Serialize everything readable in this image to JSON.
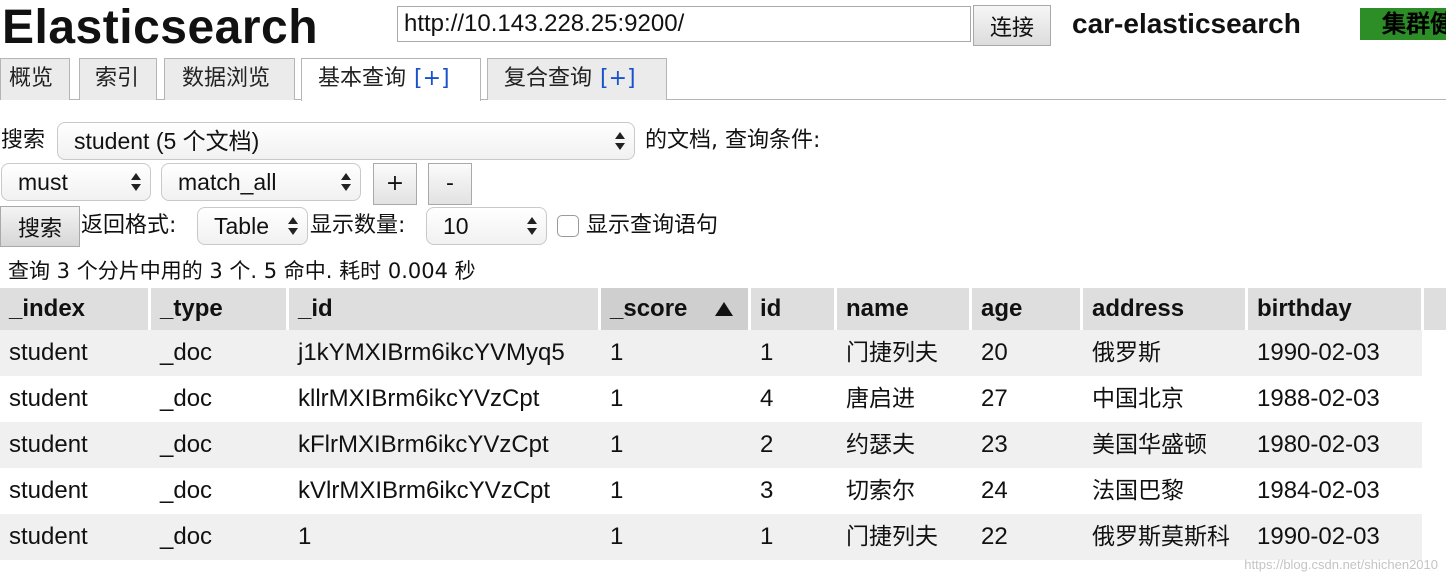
{
  "header": {
    "title": "Elasticsearch",
    "url_value": "http://10.143.228.25:9200/",
    "connect_label": "连接",
    "cluster_name": "car-elasticsearch",
    "cluster_health": "集群健",
    "health_color": "#2d8d27"
  },
  "tabs": [
    {
      "label": "概览",
      "plus": ""
    },
    {
      "label": "索引",
      "plus": ""
    },
    {
      "label": "数据浏览",
      "plus": ""
    },
    {
      "label": "基本查询",
      "plus": "[+]"
    },
    {
      "label": "复合查询",
      "plus": "[+]"
    }
  ],
  "query": {
    "search_label": "搜索",
    "index_select": "student (5 个文档)",
    "docs_label": "的文档,  查询条件:",
    "bool_select": "must",
    "type_select": "match_all",
    "plus_label": "+",
    "minus_label": "-",
    "search_button": "搜索",
    "format_label": "返回格式:",
    "format_select": "Table",
    "count_label": "显示数量:",
    "count_select": "10",
    "show_query_label": "显示查询语句",
    "show_query_checked": false
  },
  "summary": "查询 3 个分片中用的 3 个. 5 命中. 耗时 0.004 秒",
  "table": {
    "columns": [
      "_index",
      "_type",
      "_id",
      "_score",
      "id",
      "name",
      "age",
      "address",
      "birthday"
    ],
    "sorted_column": "_score",
    "rows": [
      [
        "student",
        "_doc",
        "j1kYMXIBrm6ikcYVMyq5",
        "1",
        "1",
        "门捷列夫",
        "20",
        "俄罗斯",
        "1990-02-03"
      ],
      [
        "student",
        "_doc",
        "kllrMXIBrm6ikcYVzCpt",
        "1",
        "4",
        "唐启进",
        "27",
        "中国北京",
        "1988-02-03"
      ],
      [
        "student",
        "_doc",
        "kFlrMXIBrm6ikcYVzCpt",
        "1",
        "2",
        "约瑟夫",
        "23",
        "美国华盛顿",
        "1980-02-03"
      ],
      [
        "student",
        "_doc",
        "kVlrMXIBrm6ikcYVzCpt",
        "1",
        "3",
        "切索尔",
        "24",
        "法国巴黎",
        "1984-02-03"
      ],
      [
        "student",
        "_doc",
        "1",
        "1",
        "1",
        "门捷列夫",
        "22",
        "俄罗斯莫斯科",
        "1990-02-03"
      ]
    ]
  },
  "watermark": "https://blog.csdn.net/shichen2010"
}
